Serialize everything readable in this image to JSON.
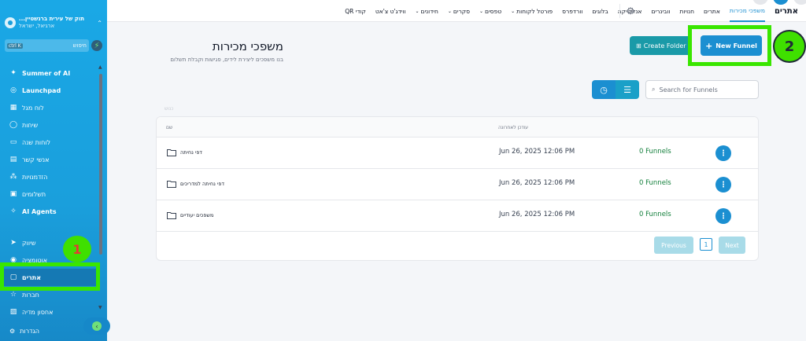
{
  "sidebar": {
    "account": {
      "name": "...תוק של עירית ברנשטיין",
      "location": "ארגיאל, ישראל"
    },
    "search": {
      "placeholder": "חיפוש",
      "shortcut": "ctrl K"
    },
    "items": [
      {
        "label": "Summer of AI",
        "icon": "sparkle-icon",
        "bold": true
      },
      {
        "label": "Launchpad",
        "icon": "rocket-icon",
        "bold": true
      },
      {
        "label": "לוח מגל",
        "icon": "grid-icon"
      },
      {
        "label": "שיחות",
        "icon": "chat-icon"
      },
      {
        "label": "לוחות שנה",
        "icon": "calendar-icon"
      },
      {
        "label": "אנשי קשר",
        "icon": "contacts-icon"
      },
      {
        "label": "הזדמנויות",
        "icon": "opportunities-icon"
      },
      {
        "label": "תשלומים",
        "icon": "payments-icon"
      },
      {
        "label": "AI Agents",
        "icon": "ai-agents-icon",
        "bold": true
      },
      {
        "label": "שיווק",
        "icon": "send-icon"
      },
      {
        "label": "אוטומציה",
        "icon": "automation-icon"
      },
      {
        "label": "אתרים",
        "icon": "sites-icon",
        "active": true
      },
      {
        "label": "חברות",
        "icon": "star-icon"
      },
      {
        "label": "אחסון מדיה",
        "icon": "media-icon"
      }
    ],
    "settings_label": "הגדרות"
  },
  "topnav": {
    "brand": "אתרים",
    "items": [
      {
        "label": "משפכי מכירות",
        "active": true
      },
      {
        "label": "אתרים"
      },
      {
        "label": "חנויות"
      },
      {
        "label": "וובינרים"
      },
      {
        "label": "אנליטיקה"
      },
      {
        "label": "בלוגים"
      },
      {
        "label": "וורדפרס"
      },
      {
        "label": "פורטל לקוחות",
        "chevron": true
      },
      {
        "label": "טפסים",
        "chevron": true
      },
      {
        "label": "סקרים",
        "chevron": true
      },
      {
        "label": "חידונים",
        "chevron": true
      },
      {
        "label": "ווידג'ט צ'אט"
      },
      {
        "label": "QR קודי"
      }
    ]
  },
  "main": {
    "title": "משפכי מכירות",
    "subtitle": "בנו משפכים ליצירת לידים, פגישות וקבלת תשלום",
    "create_folder_label": "Create Folder",
    "new_funnel_label": "New Funnel",
    "search_placeholder": "Search for Funnels",
    "faint_label": "כנוש",
    "table": {
      "col_name": "שם",
      "col_updated": "עודכן לאחרונה",
      "rows": [
        {
          "name": "דפי נחיתה",
          "date": "Jun 26, 2025 12:06 PM",
          "funnels": "0 Funnels"
        },
        {
          "name": "דפי נחיתה למדריכים",
          "date": "Jun 26, 2025 12:06 PM",
          "funnels": "0 Funnels"
        },
        {
          "name": "משפכים יעודיים",
          "date": "Jun 26, 2025 12:06 PM",
          "funnels": "0 Funnels"
        }
      ]
    },
    "pagination": {
      "previous": "Previous",
      "page": "1",
      "next": "Next"
    }
  },
  "annotations": {
    "marker_1": "1",
    "marker_2": "2"
  },
  "colors": {
    "accent": "#1b8fd1",
    "highlight": "#39e600",
    "success": "#15803d"
  }
}
